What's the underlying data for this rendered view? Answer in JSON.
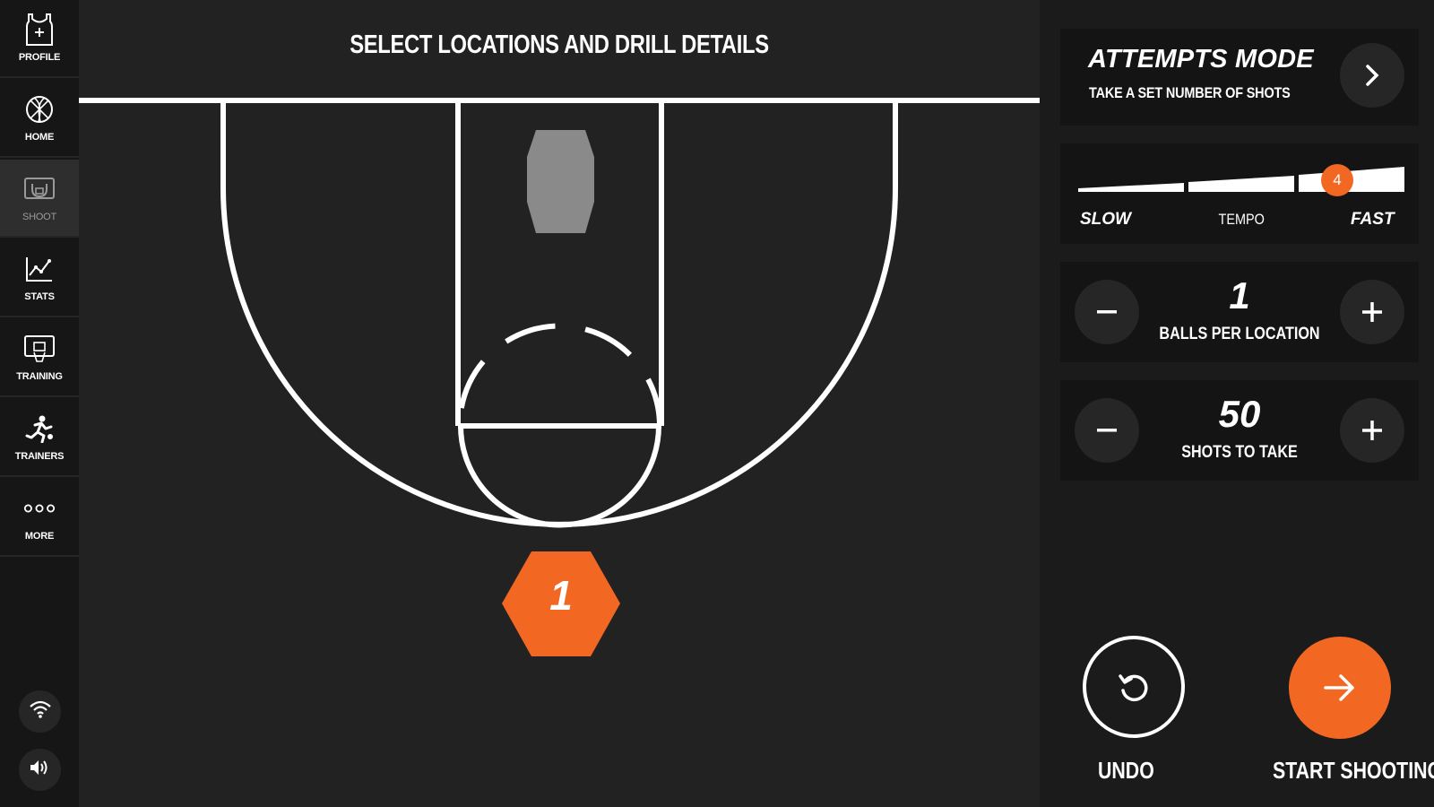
{
  "sidebar": {
    "items": [
      {
        "label": "PROFILE",
        "icon": "jersey-icon"
      },
      {
        "label": "HOME",
        "icon": "basketball-icon"
      },
      {
        "label": "SHOOT",
        "icon": "hoop-icon",
        "active": true
      },
      {
        "label": "STATS",
        "icon": "line-chart-icon"
      },
      {
        "label": "TRAINING",
        "icon": "backboard-icon"
      },
      {
        "label": "TRAINERS",
        "icon": "running-player-icon"
      },
      {
        "label": "MORE",
        "icon": "more-dots-icon"
      }
    ],
    "bottom_icons": [
      "wifi-icon",
      "speaker-icon"
    ]
  },
  "court": {
    "title": "SELECT LOCATIONS AND DRILL DETAILS",
    "selected_location": "1"
  },
  "mode": {
    "title": "ATTEMPTS MODE",
    "subtitle": "TAKE A SET NUMBER OF SHOTS"
  },
  "tempo": {
    "slow_label": "SLOW",
    "label": "TEMPO",
    "fast_label": "FAST",
    "value": "4",
    "max": 5
  },
  "balls": {
    "value": "1",
    "label": "BALLS PER LOCATION"
  },
  "shots": {
    "value": "50",
    "label": "SHOTS TO TAKE"
  },
  "actions": {
    "undo_label": "UNDO",
    "start_label": "START SHOOTING"
  },
  "colors": {
    "accent": "#f26722",
    "background": "#222222",
    "sidebar": "#161616",
    "card": "#141414"
  }
}
